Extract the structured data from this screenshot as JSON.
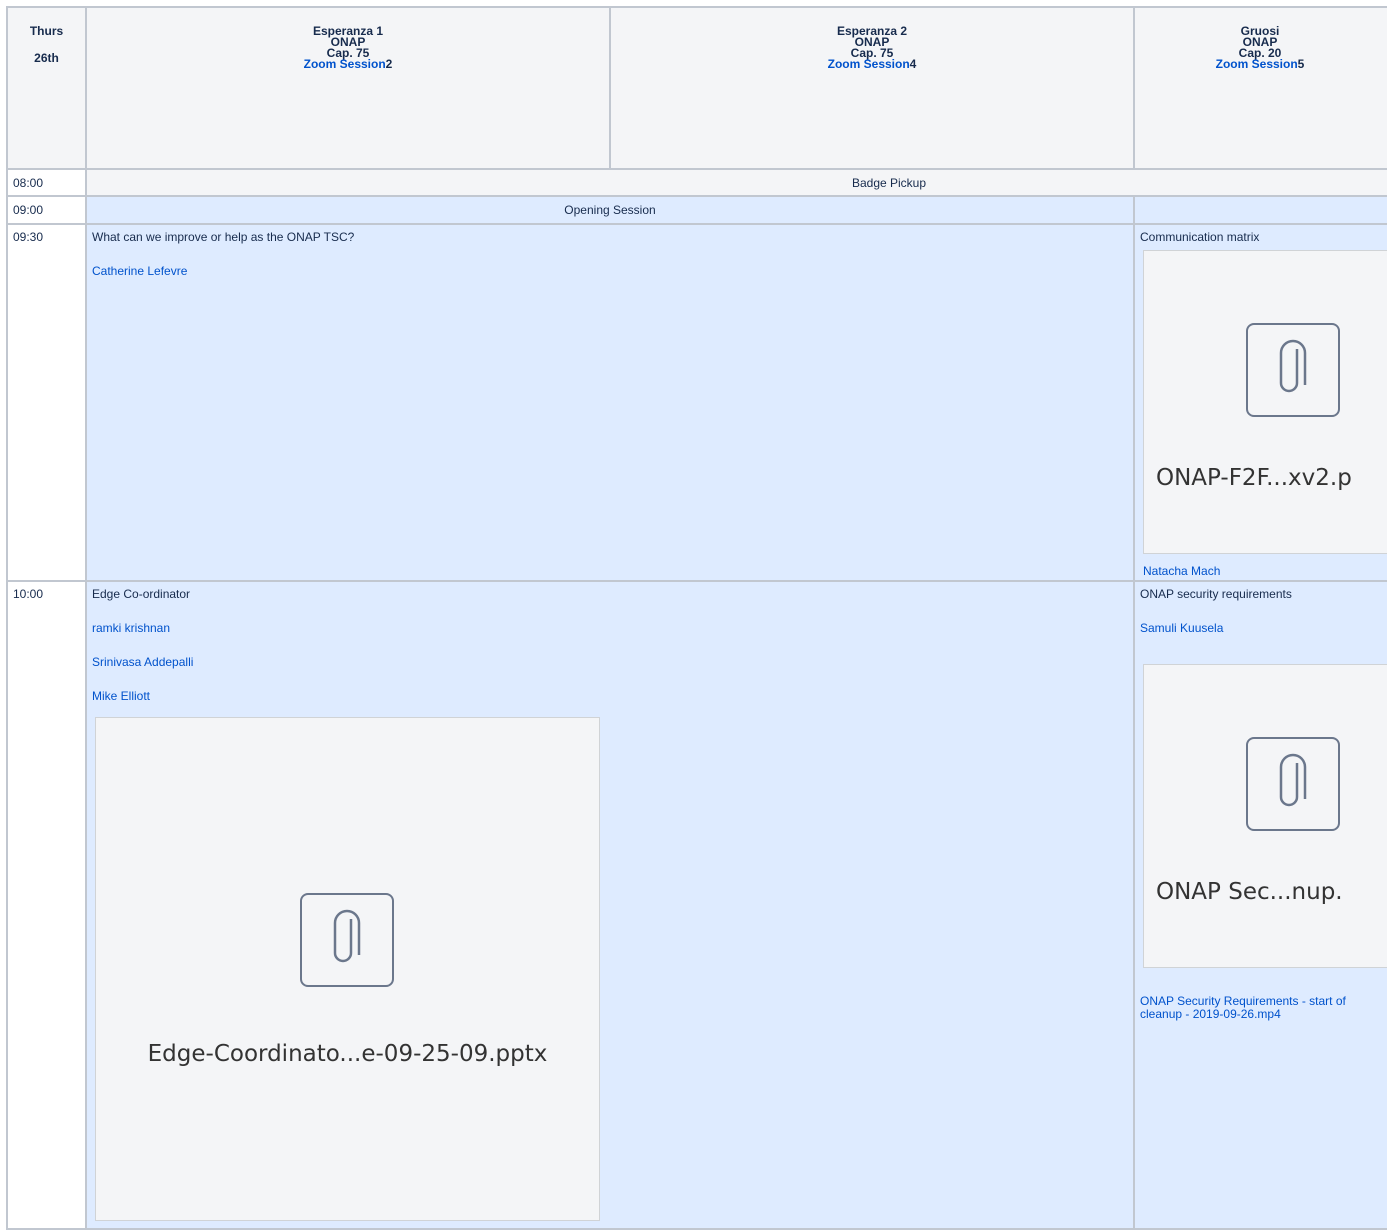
{
  "day": {
    "name": "Thurs",
    "date": "26th"
  },
  "rooms": [
    {
      "name": "Esperanza 1",
      "track": "ONAP",
      "capacity": "Cap. 75",
      "zoom_label": "Zoom Session",
      "zoom_num": "2"
    },
    {
      "name": "Esperanza 2",
      "track": "ONAP",
      "capacity": "Cap. 75",
      "zoom_label": "Zoom Session",
      "zoom_num": "4"
    },
    {
      "name": "Gruosi",
      "track": "ONAP",
      "capacity": "Cap. 20",
      "zoom_label": "Zoom Session",
      "zoom_num": "5"
    }
  ],
  "times": [
    "08:00",
    "09:00",
    "09:30",
    "10:00"
  ],
  "rows": {
    "badge": "Badge Pickup",
    "opening": "Opening Session",
    "improve": {
      "title": "What can we improve or help as the ONAP TSC?",
      "speakers": [
        "Catherine Lefevre"
      ]
    },
    "comm": {
      "title": "Communication matrix",
      "attachment": "ONAP-F2F...xv2.p",
      "speakers": [
        "Natacha Mach"
      ]
    },
    "edge": {
      "title": "Edge Co-ordinator",
      "speakers": [
        "ramki krishnan",
        "Srinivasa Addepalli",
        "Mike Elliott"
      ],
      "attachment": "Edge-Coordinato...e-09-25-09.pptx"
    },
    "security": {
      "title": "ONAP security requirements",
      "speakers": [
        "Samuli Kuusela"
      ],
      "attachment": "ONAP Sec...nup.",
      "video_link": "ONAP Security Requirements - start of cleanup - 2019-09-26.mp4"
    }
  },
  "colors": {
    "header_bg": "#f4f5f7",
    "session_bg": "#deebff",
    "link": "#0052cc",
    "border": "#c1c7d0"
  },
  "icons": [
    "paperclip-icon"
  ]
}
